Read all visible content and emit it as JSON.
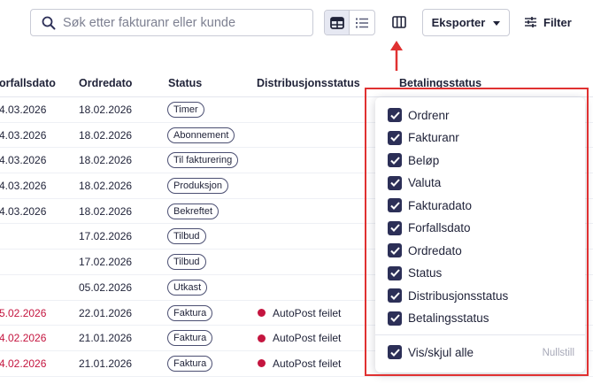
{
  "toolbar": {
    "search_placeholder": "Søk etter fakturanr eller kunde",
    "search_icon": "search-icon",
    "view_toggle": {
      "table_icon": "table-view-icon",
      "list_icon": "list-view-icon",
      "active": "table"
    },
    "columns_icon": "columns-icon",
    "export_label": "Eksporter",
    "filter_label": "Filter",
    "filter_icon": "sliders-icon"
  },
  "table": {
    "headers": {
      "forfallsdato": "orfallsdato",
      "ordredato": "Ordredato",
      "status": "Status",
      "distribusjonsstatus": "Distribusjonsstatus",
      "betalingsstatus": "Betalingsstatus"
    },
    "rows": [
      {
        "due": "4.03.2026",
        "due_overdue": false,
        "order": "18.02.2026",
        "status": "Timer",
        "dist": ""
      },
      {
        "due": "4.03.2026",
        "due_overdue": false,
        "order": "18.02.2026",
        "status": "Abonnement",
        "dist": ""
      },
      {
        "due": "4.03.2026",
        "due_overdue": false,
        "order": "18.02.2026",
        "status": "Til fakturering",
        "dist": ""
      },
      {
        "due": "4.03.2026",
        "due_overdue": false,
        "order": "18.02.2026",
        "status": "Produksjon",
        "dist": ""
      },
      {
        "due": "4.03.2026",
        "due_overdue": false,
        "order": "18.02.2026",
        "status": "Bekreftet",
        "dist": ""
      },
      {
        "due": "",
        "due_overdue": false,
        "order": "17.02.2026",
        "status": "Tilbud",
        "dist": ""
      },
      {
        "due": "",
        "due_overdue": false,
        "order": "17.02.2026",
        "status": "Tilbud",
        "dist": ""
      },
      {
        "due": "",
        "due_overdue": false,
        "order": "05.02.2026",
        "status": "Utkast",
        "dist": ""
      },
      {
        "due": "5.02.2026",
        "due_overdue": true,
        "order": "22.01.2026",
        "status": "Faktura",
        "dist": "AutoPost feilet"
      },
      {
        "due": "4.02.2026",
        "due_overdue": true,
        "order": "21.01.2026",
        "status": "Faktura",
        "dist": "AutoPost feilet"
      },
      {
        "due": "4.02.2026",
        "due_overdue": true,
        "order": "21.01.2026",
        "status": "Faktura",
        "dist": "AutoPost feilet"
      }
    ]
  },
  "column_picker": {
    "options": [
      {
        "label": "Ordrenr",
        "checked": true
      },
      {
        "label": "Fakturanr",
        "checked": true
      },
      {
        "label": "Beløp",
        "checked": true
      },
      {
        "label": "Valuta",
        "checked": true
      },
      {
        "label": "Fakturadato",
        "checked": true
      },
      {
        "label": "Forfallsdato",
        "checked": true
      },
      {
        "label": "Ordredato",
        "checked": true
      },
      {
        "label": "Status",
        "checked": true
      },
      {
        "label": "Distribusjonsstatus",
        "checked": true
      },
      {
        "label": "Betalingsstatus",
        "checked": true
      }
    ],
    "toggle_all_label": "Vis/skjul alle",
    "toggle_all_checked": true,
    "reset_label": "Nullstill"
  },
  "colors": {
    "text": "#1f2238",
    "accent": "#2c2f57",
    "overdue": "#c4153f",
    "annotation": "#e03131"
  }
}
